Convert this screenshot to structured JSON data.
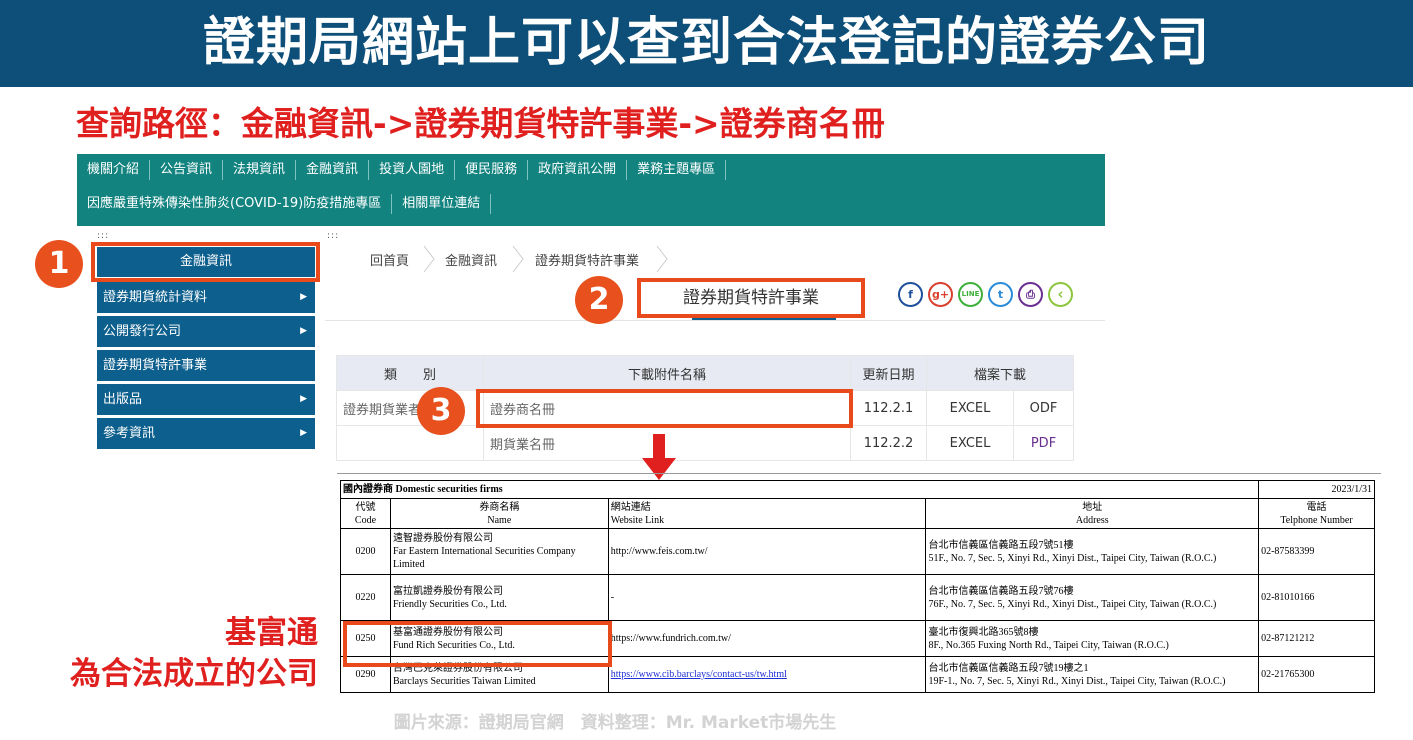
{
  "banner": {
    "title": "證期局網站上可以查到合法登記的證券公司"
  },
  "subtitle": "查詢路徑：金融資訊->證券期貨特許事業->證券商名冊",
  "nav": {
    "row1": [
      "機關介紹",
      "公告資訊",
      "法規資訊",
      "金融資訊",
      "投資人園地",
      "便民服務",
      "政府資訊公開",
      "業務主題專區"
    ],
    "row2": [
      "因應嚴重特殊傳染性肺炎(COVID-19)防疫措施專區",
      "相關單位連結"
    ]
  },
  "dots": ":::",
  "sidebar": {
    "header": "金融資訊",
    "items": [
      {
        "label": "證券期貨統計資料",
        "arrow": "▶"
      },
      {
        "label": "公開發行公司",
        "arrow": "▶"
      },
      {
        "label": "證券期貨特許事業",
        "arrow": ""
      },
      {
        "label": "出版品",
        "arrow": "▶"
      },
      {
        "label": "參考資訊",
        "arrow": "▶"
      }
    ]
  },
  "breadcrumb": [
    "回首頁",
    "金融資訊",
    "證券期貨特許事業"
  ],
  "page_heading": "證券期貨特許事業",
  "share_icons": [
    {
      "name": "facebook-icon",
      "glyph": "f",
      "color": "#1d4f9c"
    },
    {
      "name": "google-plus-icon",
      "glyph": "g+",
      "color": "#d9412e"
    },
    {
      "name": "line-icon",
      "glyph": "LINE",
      "color": "#3db03a"
    },
    {
      "name": "twitter-icon",
      "glyph": "t",
      "color": "#2a8bd8"
    },
    {
      "name": "print-icon",
      "glyph": "⎙",
      "color": "#6a2f90"
    },
    {
      "name": "back-icon",
      "glyph": "‹",
      "color": "#8cc63e"
    }
  ],
  "file_table": {
    "headers": [
      "類　　別",
      "下載附件名稱",
      "更新日期",
      "檔案下載"
    ],
    "rows": [
      {
        "type": "證券期貨業者",
        "name": "證券商名冊",
        "date": "112.2.1",
        "fmt1": "EXCEL",
        "fmt2": "ODF"
      },
      {
        "type": "",
        "name": "期貨業名冊",
        "date": "112.2.2",
        "fmt1": "EXCEL",
        "fmt2": "PDF"
      }
    ]
  },
  "securities": {
    "title": "國內證券商 Domestic securities firms",
    "date": "2023/1/31",
    "headers": {
      "code_zh": "代號",
      "code_en": "Code",
      "name_zh": "券商名稱",
      "name_en": "Name",
      "link_zh": "網站連結",
      "link_en": "Website Link",
      "addr_zh": "地址",
      "addr_en": "Address",
      "tel_zh": "電話",
      "tel_en": "Telphone Number"
    },
    "rows": [
      {
        "code": "0200",
        "name_zh": "遠智證券股份有限公司",
        "name_en": "Far Eastern International Securities Company Limited",
        "link": "http://www.feis.com.tw/",
        "addr_zh": "台北市信義區信義路五段7號51樓",
        "addr_en": "51F., No. 7, Sec. 5, Xinyi Rd., Xinyi Dist., Taipei City, Taiwan (R.O.C.)",
        "tel": "02-87583399"
      },
      {
        "code": "0220",
        "name_zh": "富拉凱證券股份有限公司",
        "name_en": "Friendly Securities Co., Ltd.",
        "link": "-",
        "addr_zh": "台北市信義區信義路五段7號76樓",
        "addr_en": "76F., No. 7, Sec. 5, Xinyi Rd., Xinyi Dist., Taipei City, Taiwan (R.O.C.)",
        "tel": "02-81010166"
      },
      {
        "code": "0250",
        "name_zh": "基富通證券股份有限公司",
        "name_en": "Fund Rich Securities Co., Ltd.",
        "link": "https://www.fundrich.com.tw/",
        "addr_zh": "臺北市復興北路365號8樓",
        "addr_en": "8F., No.365 Fuxing North Rd., Taipei City, Taiwan (R.O.C.)",
        "tel": "02-87121212"
      },
      {
        "code": "0290",
        "name_zh": "台灣巴克萊證券股份有限公司",
        "name_en": "Barclays Securities Taiwan Limited",
        "link": "https://www.cib.barclays/contact-us/tw.html",
        "addr_zh": "台北市信義區信義路五段7號19樓之1",
        "addr_en": "19F-1., No. 7, Sec. 5, Xinyi Rd., Xinyi Dist., Taipei City, Taiwan (R.O.C.)",
        "tel": "02-21765300"
      }
    ]
  },
  "steps": [
    "1",
    "2",
    "3"
  ],
  "note": {
    "line1": "基富通",
    "line2": "為合法成立的公司"
  },
  "source": "圖片來源：證期局官網　資料整理：Mr. Market市場先生",
  "colors": {
    "banner": "#0d4f78",
    "accent_red": "#e0201f",
    "nav": "#12837f",
    "sidebar": "#0d5f8d",
    "highlight": "#e84a1b"
  }
}
